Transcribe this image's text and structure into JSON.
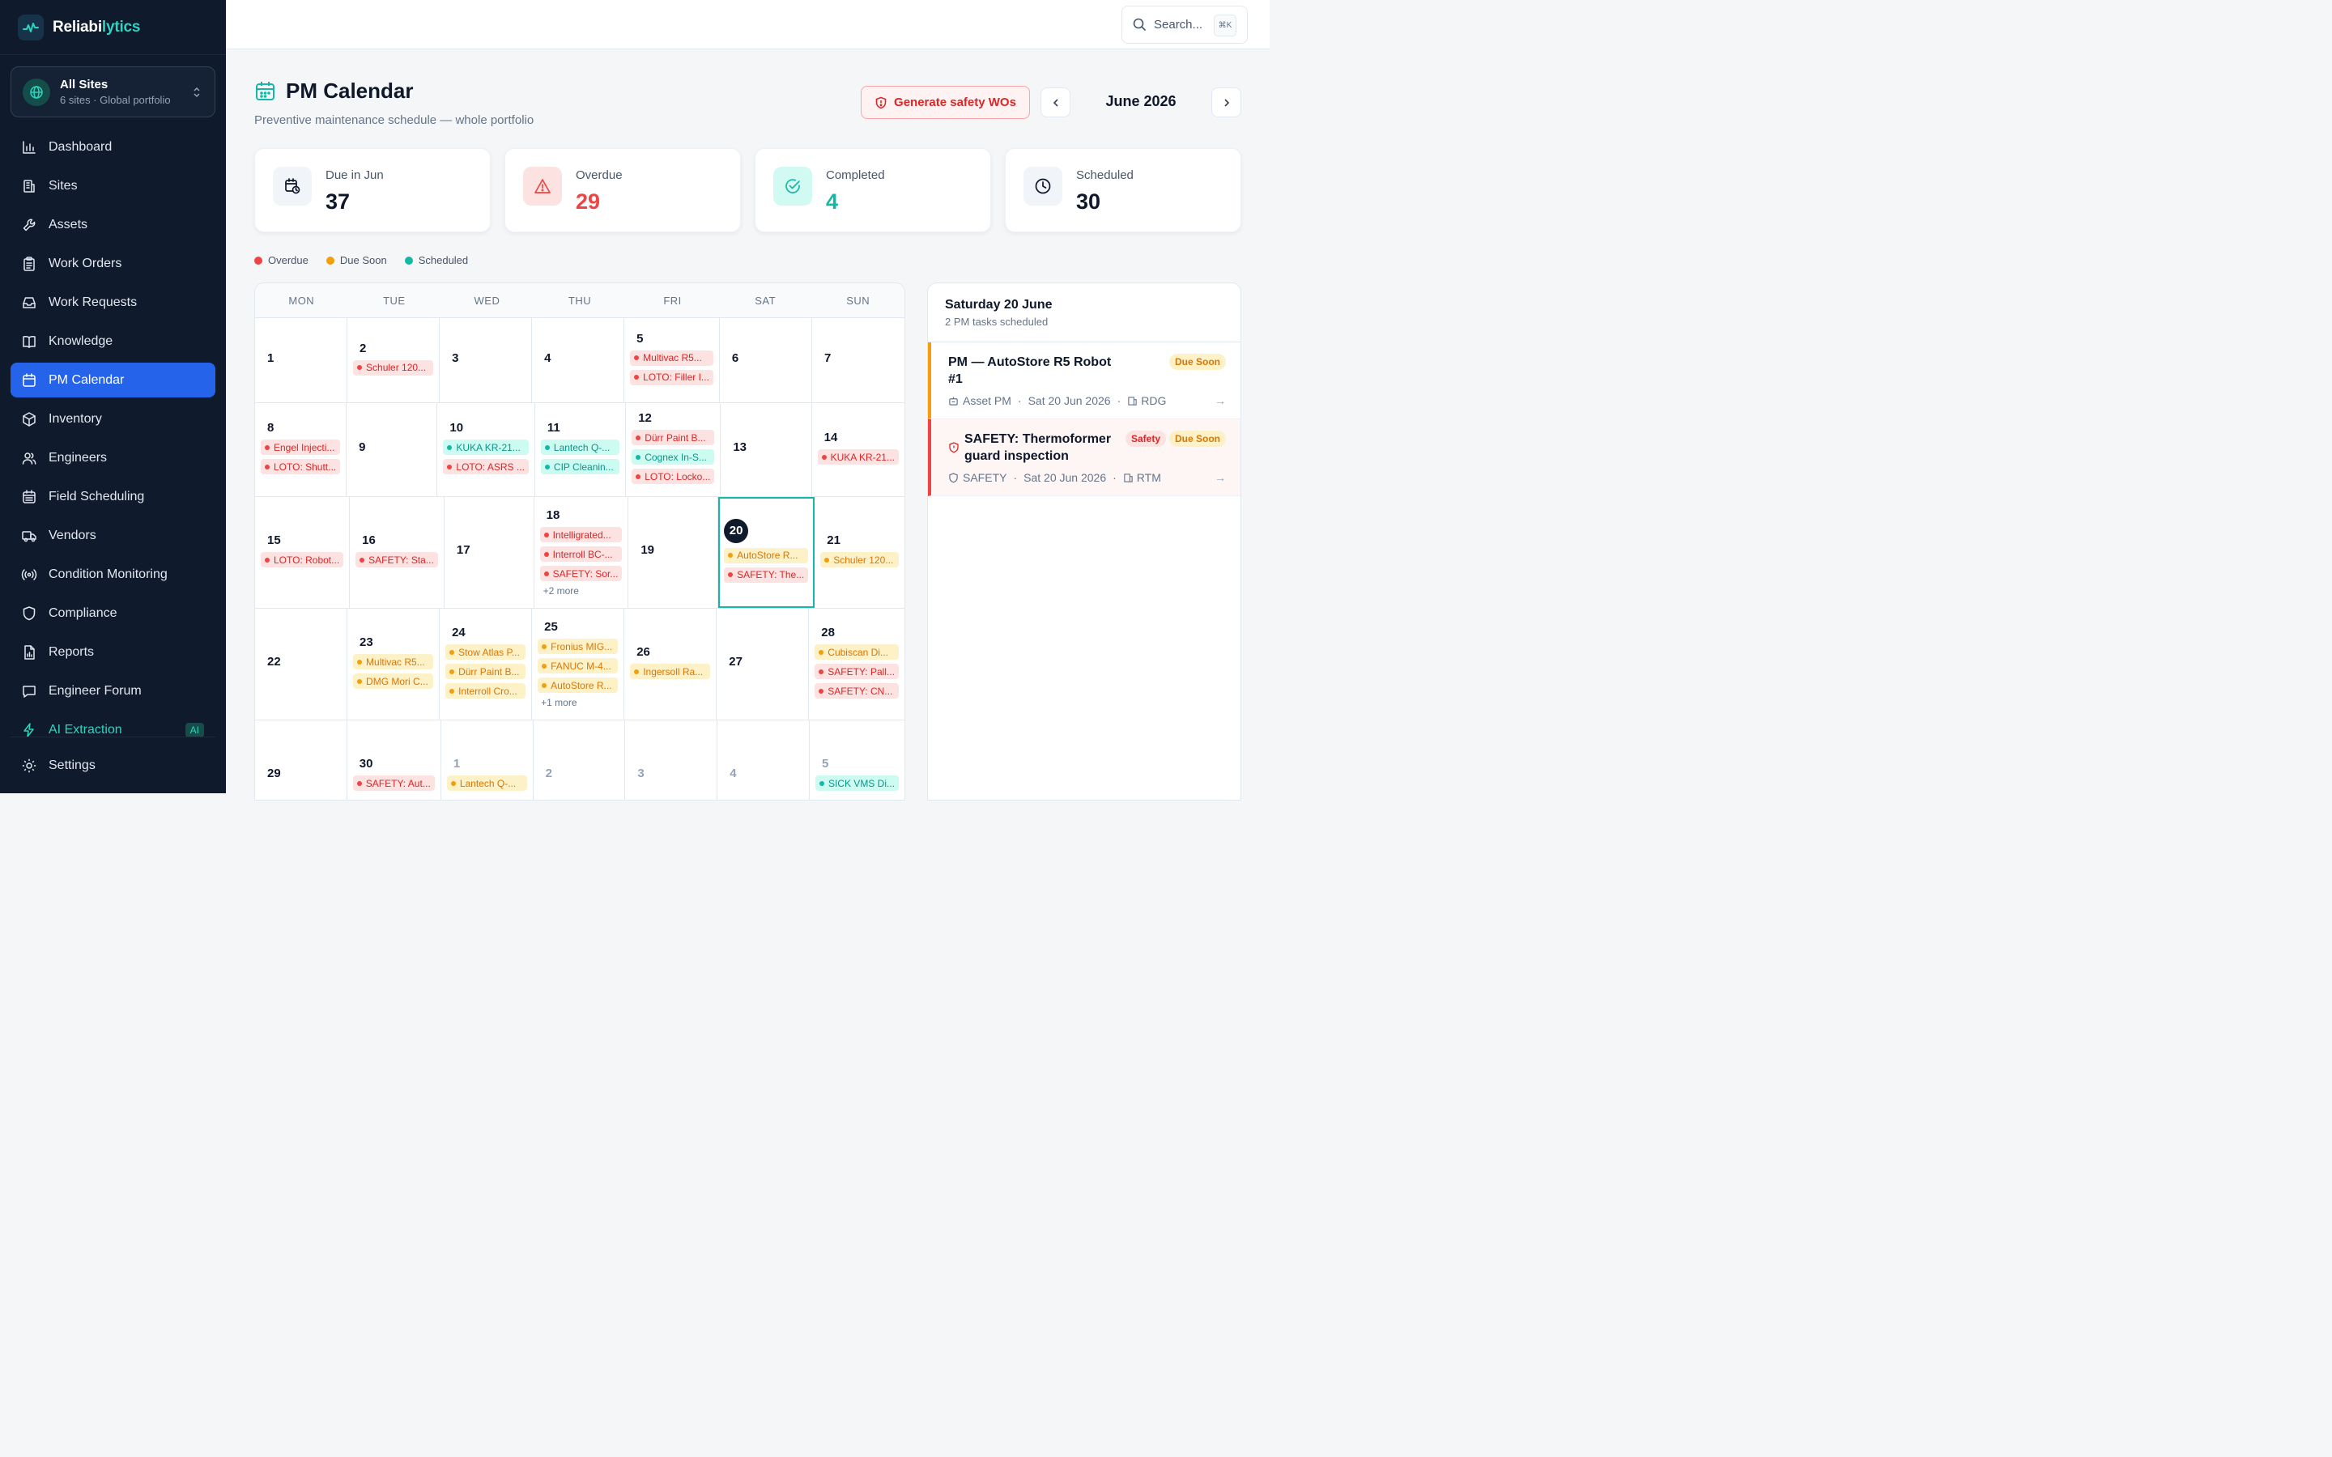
{
  "brand": {
    "name_part1": "Reliabi",
    "name_part2": "lytics"
  },
  "site_switcher": {
    "title": "All Sites",
    "subtitle": "6 sites · Global portfolio"
  },
  "nav": [
    {
      "label": "Dashboard",
      "icon": "chart-bar-icon",
      "active": false
    },
    {
      "label": "Sites",
      "icon": "building-icon",
      "active": false
    },
    {
      "label": "Assets",
      "icon": "wrench-icon",
      "active": false
    },
    {
      "label": "Work Orders",
      "icon": "clipboard-icon",
      "active": false
    },
    {
      "label": "Work Requests",
      "icon": "inbox-icon",
      "active": false
    },
    {
      "label": "Knowledge",
      "icon": "book-icon",
      "active": false
    },
    {
      "label": "PM Calendar",
      "icon": "calendar-icon",
      "active": true
    },
    {
      "label": "Inventory",
      "icon": "box-icon",
      "active": false
    },
    {
      "label": "Engineers",
      "icon": "users-icon",
      "active": false
    },
    {
      "label": "Field Scheduling",
      "icon": "calendar-grid-icon",
      "active": false
    },
    {
      "label": "Vendors",
      "icon": "truck-icon",
      "active": false
    },
    {
      "label": "Condition Monitoring",
      "icon": "radio-icon",
      "active": false
    },
    {
      "label": "Compliance",
      "icon": "shield-icon",
      "active": false
    },
    {
      "label": "Reports",
      "icon": "file-chart-icon",
      "active": false
    },
    {
      "label": "Engineer Forum",
      "icon": "message-icon",
      "active": false
    },
    {
      "label": "AI Extraction",
      "icon": "bolt-icon",
      "active": false,
      "badge": "AI"
    }
  ],
  "settings_label": "Settings",
  "search": {
    "placeholder": "Search...",
    "shortcut": "⌘K"
  },
  "header": {
    "title": "PM Calendar",
    "subtitle": "Preventive maintenance schedule — whole portfolio",
    "generate_button": "Generate safety WOs",
    "month": "June 2026"
  },
  "stats": [
    {
      "label": "Due in Jun",
      "value": "37",
      "color": "#0f172a",
      "icon": "calendar-clock-icon",
      "bg": "#f1f5f9"
    },
    {
      "label": "Overdue",
      "value": "29",
      "color": "#ef4444",
      "icon": "warning-icon",
      "bg": "#fde2e2"
    },
    {
      "label": "Completed",
      "value": "4",
      "color": "#14b8a6",
      "icon": "check-circle-icon",
      "bg": "#d1faf3"
    },
    {
      "label": "Scheduled",
      "value": "30",
      "color": "#0f172a",
      "icon": "clock-icon",
      "bg": "#f1f5f9"
    }
  ],
  "legend": [
    {
      "label": "Overdue",
      "color": "#ef4444"
    },
    {
      "label": "Due Soon",
      "color": "#f59e0b"
    },
    {
      "label": "Scheduled",
      "color": "#14b8a6"
    }
  ],
  "weekdays": [
    "MON",
    "TUE",
    "WED",
    "THU",
    "FRI",
    "SAT",
    "SUN"
  ],
  "weeks": [
    [
      {
        "day": "1",
        "events": []
      },
      {
        "day": "2",
        "events": [
          {
            "t": "Schuler 120...",
            "s": "overdue"
          }
        ]
      },
      {
        "day": "3",
        "events": []
      },
      {
        "day": "4",
        "events": []
      },
      {
        "day": "5",
        "events": [
          {
            "t": "Multivac R5...",
            "s": "overdue"
          },
          {
            "t": "LOTO: Filler I...",
            "s": "overdue"
          }
        ]
      },
      {
        "day": "6",
        "events": []
      },
      {
        "day": "7",
        "events": []
      }
    ],
    [
      {
        "day": "8",
        "events": [
          {
            "t": "Engel Injecti...",
            "s": "overdue"
          },
          {
            "t": "LOTO: Shutt...",
            "s": "overdue"
          }
        ]
      },
      {
        "day": "9",
        "events": []
      },
      {
        "day": "10",
        "events": [
          {
            "t": "KUKA KR-21...",
            "s": "scheduled"
          },
          {
            "t": "LOTO: ASRS ...",
            "s": "overdue"
          }
        ]
      },
      {
        "day": "11",
        "events": [
          {
            "t": "Lantech Q-...",
            "s": "scheduled"
          },
          {
            "t": "CIP Cleanin...",
            "s": "scheduled"
          }
        ]
      },
      {
        "day": "12",
        "events": [
          {
            "t": "Dürr Paint B...",
            "s": "overdue"
          },
          {
            "t": "Cognex In-S...",
            "s": "scheduled"
          },
          {
            "t": "LOTO: Locko...",
            "s": "overdue"
          }
        ]
      },
      {
        "day": "13",
        "events": []
      },
      {
        "day": "14",
        "events": [
          {
            "t": "KUKA KR-21...",
            "s": "overdue"
          }
        ]
      }
    ],
    [
      {
        "day": "15",
        "events": [
          {
            "t": "LOTO: Robot...",
            "s": "overdue"
          }
        ]
      },
      {
        "day": "16",
        "events": [
          {
            "t": "SAFETY: Sta...",
            "s": "overdue"
          }
        ]
      },
      {
        "day": "17",
        "events": []
      },
      {
        "day": "18",
        "events": [
          {
            "t": "Intelligrated...",
            "s": "overdue"
          },
          {
            "t": "Interroll BC-...",
            "s": "overdue"
          },
          {
            "t": "SAFETY: Sor...",
            "s": "overdue"
          }
        ],
        "more": "+2 more"
      },
      {
        "day": "19",
        "events": []
      },
      {
        "day": "20",
        "events": [
          {
            "t": "AutoStore R...",
            "s": "soon"
          },
          {
            "t": "SAFETY: The...",
            "s": "overdue"
          }
        ],
        "today": true
      },
      {
        "day": "21",
        "events": [
          {
            "t": "Schuler 120...",
            "s": "soon"
          }
        ]
      }
    ],
    [
      {
        "day": "22",
        "events": []
      },
      {
        "day": "23",
        "events": [
          {
            "t": "Multivac R5...",
            "s": "soon"
          },
          {
            "t": "DMG Mori C...",
            "s": "soon"
          }
        ]
      },
      {
        "day": "24",
        "events": [
          {
            "t": "Stow Atlas P...",
            "s": "soon"
          },
          {
            "t": "Dürr Paint B...",
            "s": "soon"
          },
          {
            "t": "Interroll Cro...",
            "s": "soon"
          }
        ]
      },
      {
        "day": "25",
        "events": [
          {
            "t": "Fronius MIG...",
            "s": "soon"
          },
          {
            "t": "FANUC M-4...",
            "s": "soon"
          },
          {
            "t": "AutoStore R...",
            "s": "soon"
          }
        ],
        "more": "+1 more"
      },
      {
        "day": "26",
        "events": [
          {
            "t": "Ingersoll Ra...",
            "s": "soon"
          }
        ]
      },
      {
        "day": "27",
        "events": []
      },
      {
        "day": "28",
        "events": [
          {
            "t": "Cubiscan Di...",
            "s": "soon"
          },
          {
            "t": "SAFETY: Pall...",
            "s": "overdue"
          },
          {
            "t": "SAFETY: CN...",
            "s": "overdue"
          }
        ]
      }
    ],
    [
      {
        "day": "29",
        "events": []
      },
      {
        "day": "30",
        "events": [
          {
            "t": "SAFETY: Aut...",
            "s": "overdue"
          }
        ]
      },
      {
        "day": "1",
        "events": [
          {
            "t": "Lantech Q-...",
            "s": "soon"
          }
        ],
        "out": true
      },
      {
        "day": "2",
        "events": [],
        "out": true
      },
      {
        "day": "3",
        "events": [],
        "out": true
      },
      {
        "day": "4",
        "events": [],
        "out": true
      },
      {
        "day": "5",
        "events": [
          {
            "t": "SICK VMS Di...",
            "s": "scheduled"
          }
        ],
        "out": true
      }
    ]
  ],
  "detail": {
    "title": "Saturday 20 June",
    "subtitle": "2 PM tasks scheduled",
    "tasks": [
      {
        "title": "PM — AutoStore R5 Robot #1",
        "type": "Asset PM",
        "date": "Sat 20 Jun 2026",
        "site": "RDG",
        "status": "Due Soon",
        "kind": "soon"
      },
      {
        "title": "SAFETY: Thermoformer guard inspection",
        "type": "SAFETY",
        "date": "Sat 20 Jun 2026",
        "site": "RTM",
        "status": "Due Soon",
        "safety_tag": "Safety",
        "kind": "safety"
      }
    ]
  }
}
